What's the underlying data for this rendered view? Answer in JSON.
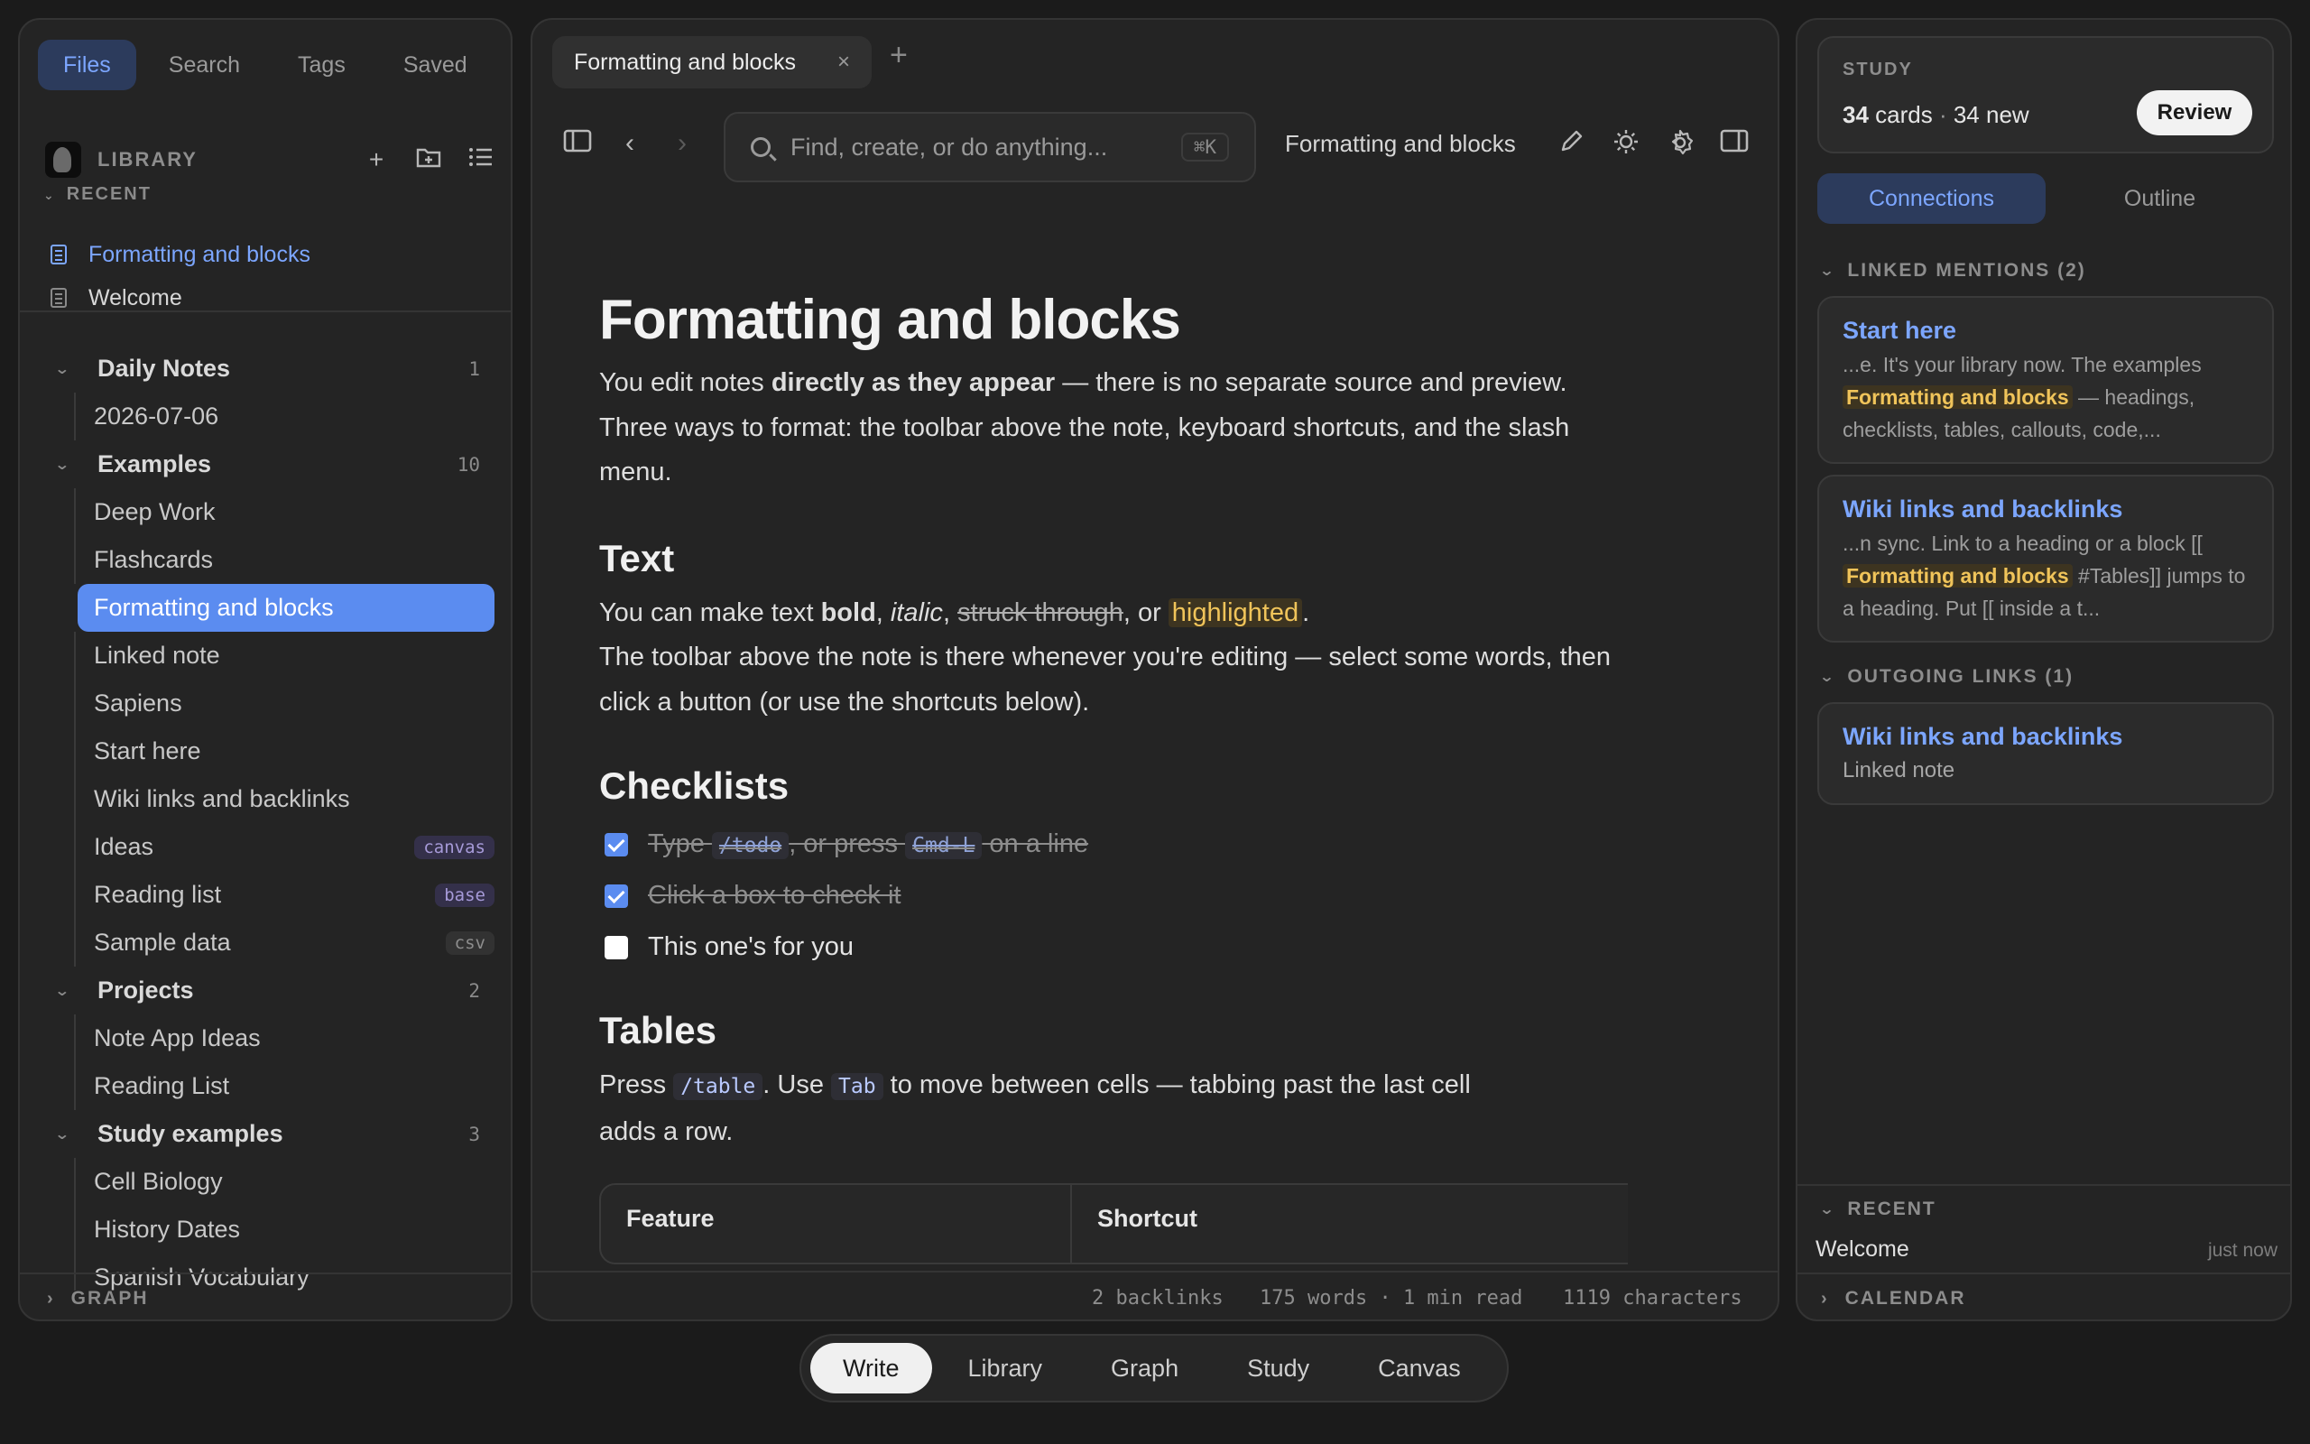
{
  "left": {
    "tabs": [
      "Files",
      "Search",
      "Tags",
      "Saved"
    ],
    "library_title": "LIBRARY",
    "icons": [
      "plus-icon",
      "new-folder-icon",
      "list-icon"
    ],
    "recent_label": "RECENT",
    "recent_items": [
      "Formatting and blocks",
      "Welcome"
    ],
    "tree": [
      {
        "label": "Daily Notes",
        "count": "1",
        "items": [
          {
            "label": "2026-07-06"
          }
        ]
      },
      {
        "label": "Examples",
        "count": "10",
        "items": [
          {
            "label": "Deep Work"
          },
          {
            "label": "Flashcards"
          },
          {
            "label": "Formatting and blocks",
            "selected": true
          },
          {
            "label": "Linked note"
          },
          {
            "label": "Sapiens"
          },
          {
            "label": "Start here"
          },
          {
            "label": "Wiki links and backlinks"
          },
          {
            "label": "Ideas",
            "badge": "canvas"
          },
          {
            "label": "Reading list",
            "badge": "base"
          },
          {
            "label": "Sample data",
            "badge": "csv"
          }
        ]
      },
      {
        "label": "Projects",
        "count": "2",
        "items": [
          {
            "label": "Note App Ideas"
          },
          {
            "label": "Reading List"
          }
        ]
      },
      {
        "label": "Study examples",
        "count": "3",
        "items": [
          {
            "label": "Cell Biology"
          },
          {
            "label": "History Dates"
          },
          {
            "label": "Spanish Vocabulary"
          }
        ]
      }
    ],
    "graph_label": "GRAPH"
  },
  "center": {
    "tab_label": "Formatting and blocks",
    "search_placeholder": "Find, create, or do anything...",
    "search_shortcut": "⌘K",
    "doc_title": "Formatting and blocks",
    "doc": {
      "h1": "Formatting and blocks",
      "intro": {
        "a": "You edit notes ",
        "b": "directly as they appear",
        "c": " — there is no separate source and preview. Three ways to format: the toolbar above the note, keyboard shortcuts, and the slash menu."
      },
      "text_h": "Text",
      "text_p": {
        "a": "You can make text ",
        "bold": "bold",
        "s1": ", ",
        "italic": "italic",
        "s2": ", ",
        "strike": "struck through",
        "s3": ", or ",
        "hl": "highlighted",
        "s4": "."
      },
      "text_p2": "The toolbar above the note is there whenever you're editing — select some words, then click a button (or use the shortcuts below).",
      "check_h": "Checklists",
      "check1": {
        "a": "Type ",
        "code1": "/todo",
        "b": ", or press ",
        "code2": "Cmd-L",
        "c": " on a line"
      },
      "check2": "Click a box to check it",
      "check3": "This one's for you",
      "tables_h": "Tables",
      "tables_p": {
        "a": "Press ",
        "code1": "/table",
        "b": ". Use ",
        "code2": "Tab",
        "c": " to move between cells — tabbing past the last cell adds a row."
      },
      "table_headers": [
        "Feature",
        "Shortcut"
      ]
    },
    "status": {
      "backlinks": "2 backlinks",
      "words": "175 words · 1 min read",
      "chars": "1119 characters"
    }
  },
  "right": {
    "study_label": "STUDY",
    "cards": "34",
    "cards_suffix": " cards",
    "new": "34 new",
    "review_label": "Review",
    "tabs": [
      "Connections",
      "Outline"
    ],
    "linked_label": "LINKED MENTIONS (2)",
    "mentions": [
      {
        "title": "Start here",
        "pre": "...e. It's your library now. The examples ",
        "hl": "Formatting and blocks",
        "post": " — headings, checklists, tables, callouts, code,..."
      },
      {
        "title": "Wiki links and backlinks",
        "pre": "...n sync. Link to a heading or a block [[ ",
        "hl": "Formatting and blocks",
        "post": " #Tables]] jumps to a heading. Put [[ inside a t..."
      }
    ],
    "outgoing_label": "OUTGOING LINKS (1)",
    "outgoing": {
      "title": "Wiki links and backlinks",
      "sub": "Linked note"
    },
    "recent_label": "RECENT",
    "recent_item": "Welcome",
    "recent_when": "just now",
    "calendar_label": "CALENDAR"
  },
  "bottom_nav": [
    "Write",
    "Library",
    "Graph",
    "Study",
    "Canvas"
  ]
}
